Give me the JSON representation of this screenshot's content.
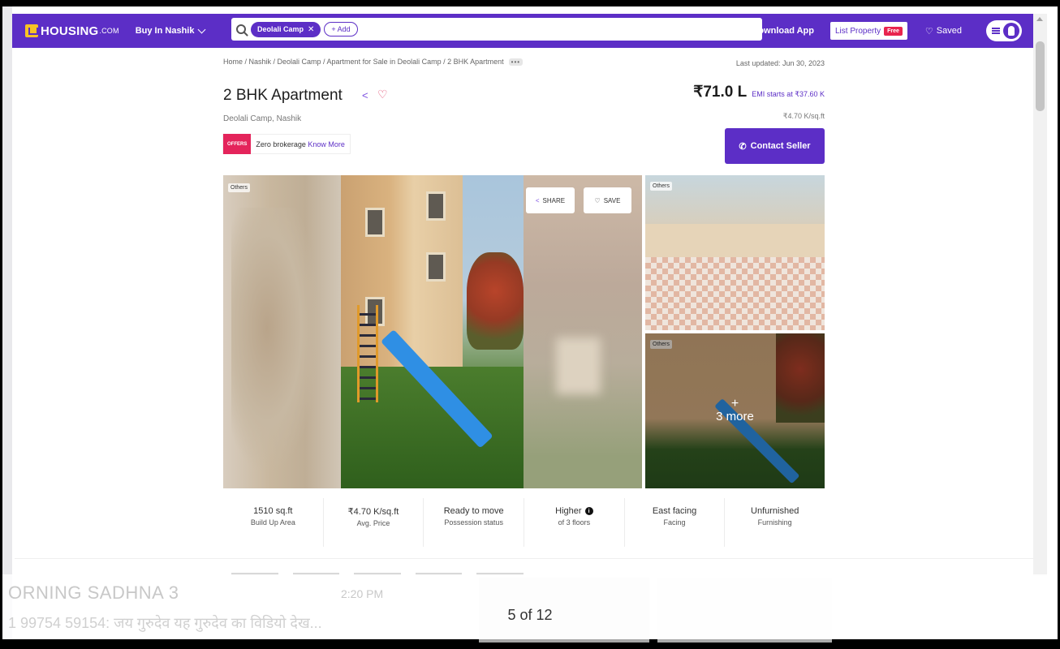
{
  "nav": {
    "logo_main": "HOUSING",
    "logo_suffix": ".COM",
    "buy_dropdown": "Buy In Nashik",
    "search_chip": "Deolali Camp",
    "add_chip": "+ Add",
    "download_app": "Download App",
    "list_property": "List Property",
    "free_badge": "Free",
    "saved": "Saved"
  },
  "breadcrumb": "Home / Nashik / Deolali Camp / Apartment for Sale in Deolali Camp / 2 BHK Apartment",
  "breadcrumb_more": "•••",
  "last_updated": "Last updated: Jun 30, 2023",
  "listing": {
    "title": "2 BHK Apartment",
    "locality": "Deolali Camp, Nashik",
    "offer_tag": "OFFERS",
    "offer_text": "Zero brokerage",
    "offer_link": "Know More",
    "price": "₹71.0 L",
    "emi": "EMI starts at ₹37.60 K",
    "price_per_sqft": "₹4.70 K/sq.ft",
    "contact_button": "Contact Seller"
  },
  "gallery": {
    "main_tag": "Others",
    "share": "SHARE",
    "save": "SAVE",
    "thumb1_tag": "Others",
    "thumb2_tag": "Others",
    "more_plus": "+",
    "more_text": "3 more"
  },
  "stats": [
    {
      "value": "1510 sq.ft",
      "label": "Build Up Area"
    },
    {
      "value": "₹4.70 K/sq.ft",
      "label": "Avg. Price"
    },
    {
      "value": "Ready to move",
      "label": "Possession status"
    },
    {
      "value": "Higher",
      "label": "of 3 floors"
    },
    {
      "value": "East facing",
      "label": "Facing"
    },
    {
      "value": "Unfurnished",
      "label": "Furnishing"
    }
  ],
  "overlay": {
    "ghost_title": "ORNING SADHNA 3",
    "ghost_time": "2:20 PM",
    "ghost_sub": "1 99754 59154: जय गुरुदेव यह गुरुदेव का विडियो देख...",
    "counter": "5 of 12"
  },
  "colors": {
    "brand": "#5c2ec6",
    "offer": "#e4245b"
  }
}
